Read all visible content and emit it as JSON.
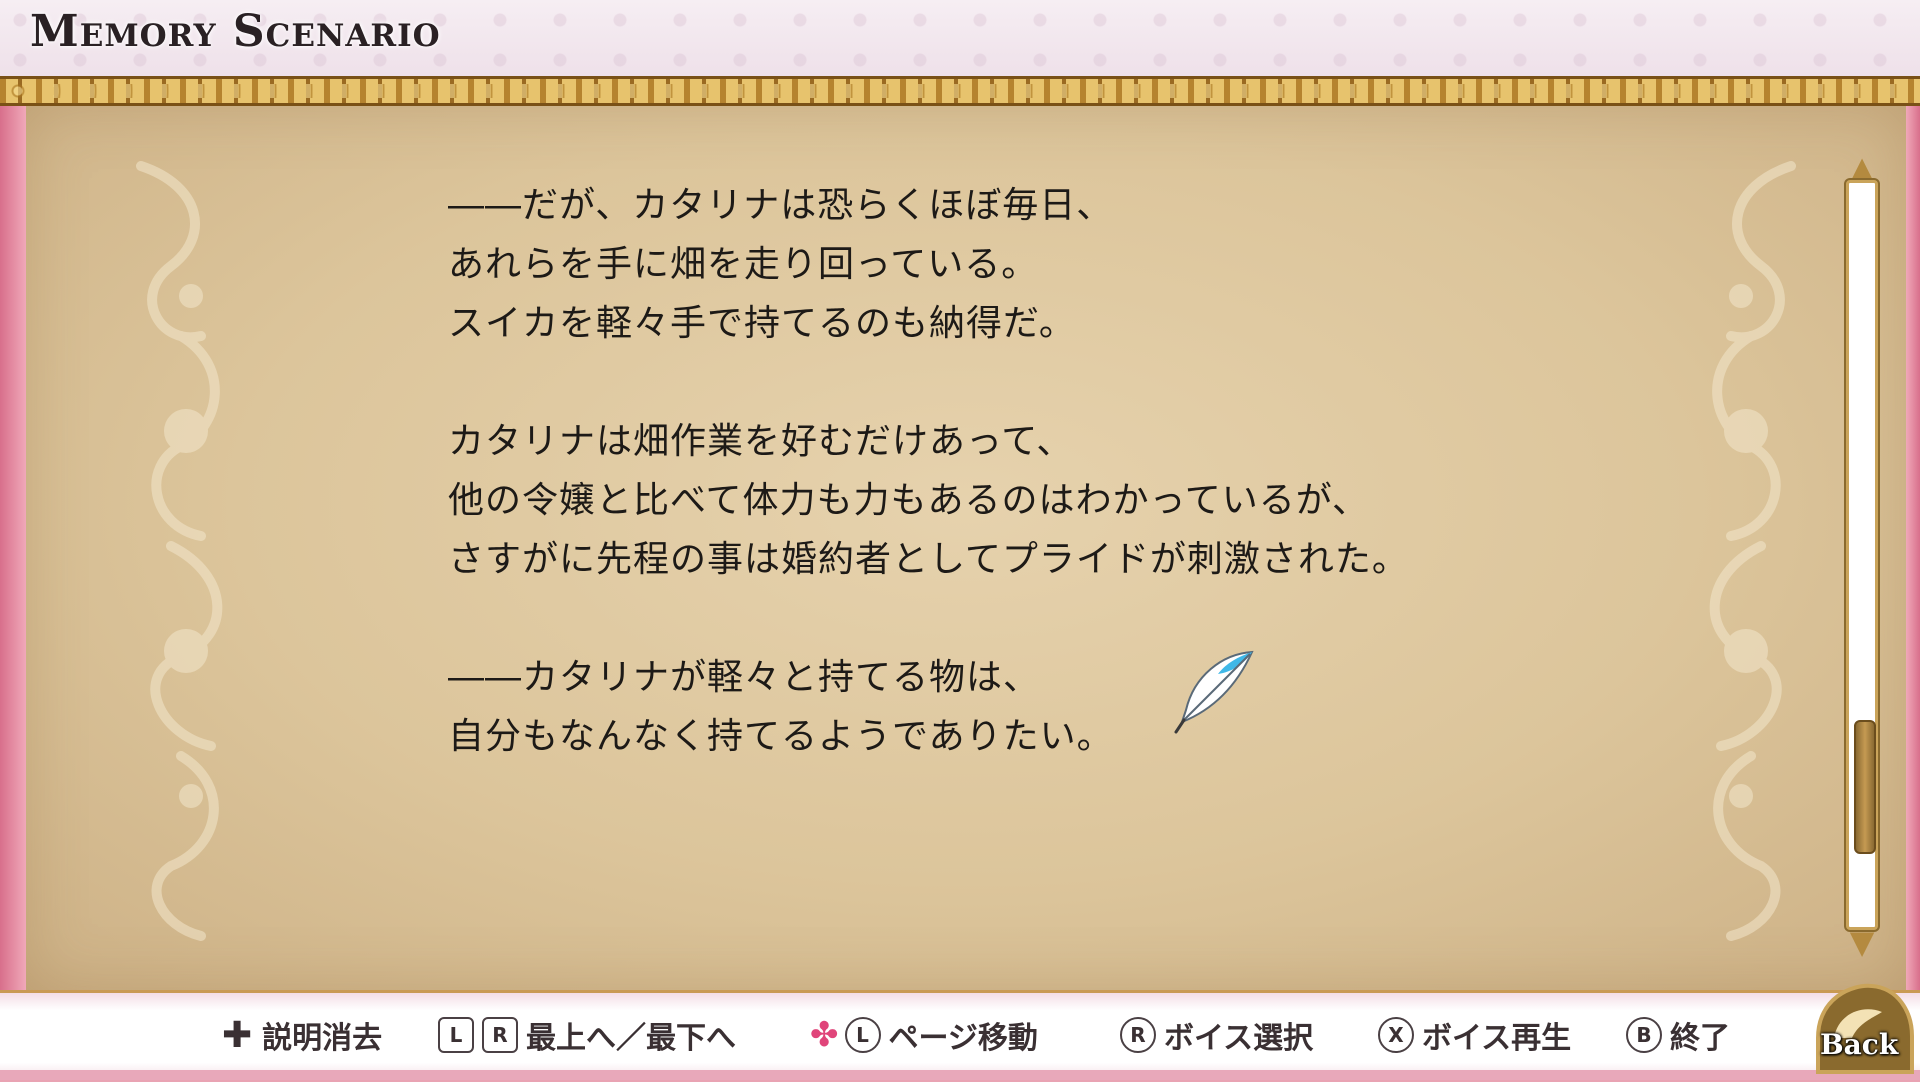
{
  "header": {
    "title": "Memory Scenario"
  },
  "story": {
    "lines": [
      "――だが、カタリナは恐らくほぼ毎日、",
      "あれらを手に畑を走り回っている。",
      "スイカを軽々手で持てるのも納得だ。",
      "",
      "カタリナは畑作業を好むだけあって、",
      "他の令嬢と比べて体力も力もあるのはわかっているが、",
      "さすがに先程の事は婚約者としてプライドが刺激された。",
      "",
      "――カタリナが軽々と持てる物は、",
      "自分もなんなく持てるようでありたい。"
    ]
  },
  "scrollbar": {
    "position_fraction": 0.88,
    "visible_fraction": 0.18
  },
  "controls": {
    "hide_help": {
      "icon": "dpad-icon",
      "label": "説明消去"
    },
    "top_bottom": {
      "key_l": "L",
      "key_r": "R",
      "label": "最上へ／最下へ"
    },
    "page_move": {
      "key": "L",
      "label": "ページ移動"
    },
    "voice_select": {
      "key": "R",
      "label": "ボイス選択"
    },
    "voice_play": {
      "key": "X",
      "label": "ボイス再生"
    },
    "end": {
      "key": "B",
      "label": "終了"
    }
  },
  "back": {
    "label": "Back"
  },
  "colors": {
    "pink": "#e9a3b3",
    "gold": "#c99842",
    "parchment": "#dcc59b",
    "feather_accent": "#3fb8e8"
  }
}
